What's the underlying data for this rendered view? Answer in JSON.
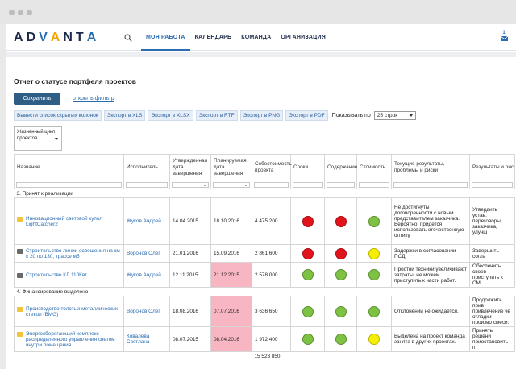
{
  "brand": {
    "logo_text": "ADVANTA",
    "colors": {
      "primary": "#2b6cb0",
      "accent": "#f4a300",
      "nav_dark": "#1c2a4a",
      "save_btn": "#2e5d86",
      "highlight_pink": "#f7b6c2"
    }
  },
  "nav": {
    "items": [
      {
        "label": "МОЯ РАБОТА",
        "active": true
      },
      {
        "label": "КАЛЕНДАРЬ",
        "active": false
      },
      {
        "label": "КОМАНДА",
        "active": false
      },
      {
        "label": "ОРГАНИЗАЦИЯ",
        "active": false
      }
    ],
    "mail_count": "1",
    "icons": {
      "search": "search-icon",
      "mail": "mail-icon"
    }
  },
  "page": {
    "title": "Отчет о статусе портфеля проектов",
    "save_label": "Сохранить",
    "filter_link": "открыть фильтр"
  },
  "toolbar": {
    "buttons": [
      "Вывести список скрытых колонок",
      "Экспорт в XLS",
      "Экспорт в XLSX",
      "Экспорт в RTF",
      "Экспорт в PNG",
      "Экспорт в PDF"
    ],
    "show_label": "Показывать по",
    "rows_select": "25 строк"
  },
  "lifecycle_filter": "Жизненный цикл проектов",
  "table": {
    "headers": [
      "Название",
      "Исполнитель",
      "Утвержденная дата завершения",
      "Планируемая дата завершения",
      "Себестоимость проекта",
      "Сроки",
      "Содержание",
      "Стоимость",
      "Текущие результаты, проблемы и риски",
      "Результаты и риски на следующий период"
    ],
    "groups": [
      {
        "label": "3. Принят к реализации",
        "rows": [
          {
            "name": "Инновационный световой купол LightCatcher2",
            "icon": "folder-yellow",
            "owner": "Жуков Андрей",
            "approved_date": "14.04.2015",
            "planned_date": "18.10.2016",
            "planned_highlight": false,
            "cost": "4 475 200",
            "status_time": "red",
            "status_scope": "red",
            "status_cost": "green",
            "current": "Не достигнуты договоренности с новым представителем заказчика. Вероятно, придется использовать отечественную оптику.",
            "next": "Утвердить устав. переговоры заказчика, улучш"
          },
          {
            "name": "Строительство линии освещения на км с 20 по 130, трассе м5",
            "icon": "folder-dark",
            "owner": "Воронов Олег",
            "approved_date": "21.01.2016",
            "planned_date": "15.09.2016",
            "planned_highlight": false,
            "cost": "2 861 600",
            "status_time": "red",
            "status_scope": "red",
            "status_cost": "yellow",
            "current": "Задержки в согласовании ПСД.",
            "next": "Завершить согла"
          },
          {
            "name": "Строительство КЛ 110Квт",
            "icon": "folder-dark",
            "owner": "Жуков Андрей",
            "approved_date": "12.11.2015",
            "planned_date": "21.12.2015",
            "planned_highlight": true,
            "cost": "2 578 000",
            "status_time": "green",
            "status_scope": "green",
            "status_cost": "green",
            "current": "Простои техники увеличивают затраты, не можем приступить к части работ.",
            "next": "Обеспечить своев приступить к СМ"
          }
        ]
      },
      {
        "label": "4. Финансирование выделено",
        "rows": [
          {
            "name": "Производство толстых металлических стекол (BMG)",
            "icon": "folder-yellow",
            "owner": "Воронов Олег",
            "approved_date": "18.08.2016",
            "planned_date": "07.07.2016",
            "planned_highlight": true,
            "cost": "3 636 650",
            "status_time": "green",
            "status_scope": "green",
            "status_cost": "green",
            "current": "Отклонений не ожидается.",
            "next": "Продолжить прив привлечение че отладки произво смеси."
          },
          {
            "name": "Энергосберегающий комплекс распределенного управления светом внутри помещения",
            "icon": "folder-yellow",
            "owner": "Ковалева Светлана",
            "approved_date": "08.07.2015",
            "planned_date": "08.04.2016",
            "planned_highlight": true,
            "cost": "1 972 400",
            "status_time": "green",
            "status_scope": "green",
            "status_cost": "yellow",
            "current": "Выделена на проект команда занята в других проектах.",
            "next": "Принять решени приостановить п"
          }
        ]
      }
    ],
    "total_cost": "15 523 850"
  }
}
